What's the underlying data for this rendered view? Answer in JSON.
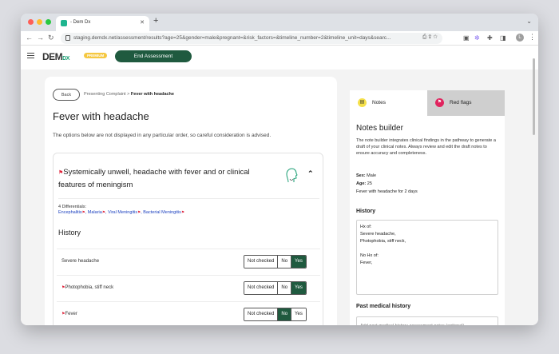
{
  "browser": {
    "tab_title": "- Dem Dx",
    "url": "staging.demdx.net/assessment/results?age=25&gender=male&pregnant=&risk_factors=&timeline_number=2&timeline_unit=days&searc...",
    "avatar_letter": "L"
  },
  "app": {
    "logo_main": "DEM",
    "logo_sub": "DX",
    "premium_badge": "PREMIUM",
    "end_button": "End Assessment"
  },
  "main": {
    "back_label": "Back",
    "breadcrumb_parent": "Presenting Complaint",
    "breadcrumb_sep": ">",
    "breadcrumb_current": "Fever with headache",
    "title": "Fever with headache",
    "note": "The options below are not displayed in any particular order, so careful consideration is advised."
  },
  "differential": {
    "title": "Systemically unwell, headache with fever and or clinical features of meningism",
    "count_label": "4 Differentials:",
    "items": [
      "Encephalitis",
      "Malaria",
      "Viral Meningitis",
      "Bacterial Meningitis"
    ],
    "history_heading": "History",
    "rows": [
      {
        "label": "Severe headache",
        "flag": false,
        "selected": "Yes"
      },
      {
        "label": "Photophobia, stiff neck",
        "flag": true,
        "selected": "Yes"
      },
      {
        "label": "Fever",
        "flag": true,
        "selected": "No"
      }
    ],
    "options": [
      "Not checked",
      "No",
      "Yes"
    ]
  },
  "sidebar": {
    "tab_notes": "Notes",
    "tab_redflags": "Red flags",
    "title": "Notes builder",
    "description": "The note builder integrates clinical findings in the pathway to generate a draft of your clinical notes. Always review and edit the draft notes to ensure accuracy and completeness.",
    "sex_label": "Sex:",
    "sex_value": "Male",
    "age_label": "Age:",
    "age_value": "25",
    "complaint": "Fever with headache for 2 days",
    "history_heading": "History",
    "history_notes": "Hx of:\nSevere headache,\nPhotophobia, stiff neck,\n\nNo Hx of:\nFever,",
    "pmh_heading": "Past medical history",
    "pmh_placeholder": "Add past medical history assessment notes (optional)"
  },
  "colors": {
    "brand_green": "#1f5a3f",
    "flag_red": "#e0243b",
    "premium_yellow": "#f5c842",
    "link_blue": "#1a3fbf"
  }
}
